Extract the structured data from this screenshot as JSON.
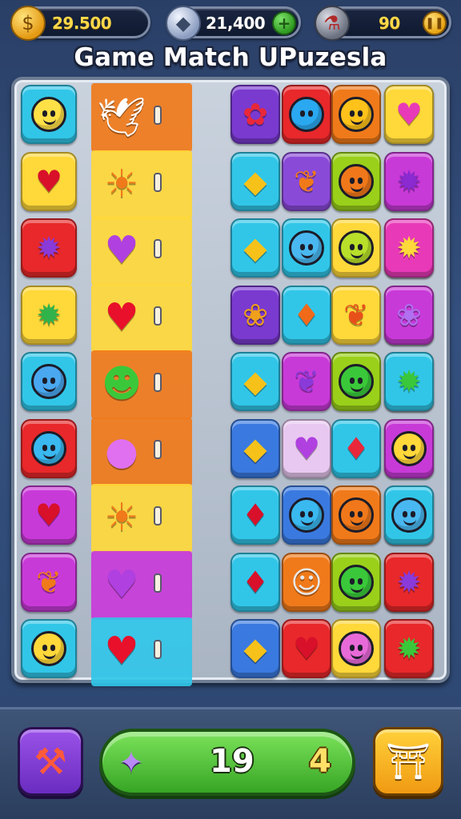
{
  "hud": {
    "coins": {
      "icon": "coin-bag-icon",
      "value": "29.500"
    },
    "gems": {
      "icon": "diamond-icon",
      "value": "21,400"
    },
    "energy": {
      "icon": "potion-icon",
      "value": "90"
    }
  },
  "title": "Game Match UPuzesla",
  "board": {
    "columns": 7,
    "rows": 9,
    "tiles": [
      [
        {
          "c": "#31c6e8",
          "s": "face",
          "f": "#ffe046"
        },
        {
          "c": "wide"
        },
        {
          "c": "wide"
        },
        {
          "c": "#7a3ad0",
          "s": "glyph",
          "g": "✿",
          "gc": "#e8283a"
        },
        {
          "c": "#e8282a",
          "s": "face-plain",
          "f": "#2aa8f0"
        },
        {
          "c": "#f07a1a",
          "s": "face",
          "f": "#ffc21a"
        },
        {
          "c": "#2fb34a",
          "s": "glyph",
          "g": "♥",
          "gc": "#3a9cf0"
        },
        {
          "c": "#ffd83a",
          "s": "glyph",
          "g": "♥",
          "gc": "#e83ab8"
        }
      ],
      [
        {
          "c": "#ffd83a",
          "s": "glyph",
          "g": "♥",
          "gc": "#d8102a"
        },
        {
          "c": "strip"
        },
        {
          "c": "#31c6e8",
          "s": "glyph",
          "g": "◆",
          "gc": "#f6c21a"
        },
        {
          "c": "#8a4ad8",
          "s": "glyph",
          "g": "❦",
          "gc": "#f07a1a"
        },
        {
          "c": "#9ad01a",
          "s": "face",
          "f": "#f0781a"
        },
        {
          "c": "#31c6e8",
          "s": "face",
          "f": "#4aa8f0"
        },
        {
          "c": "#c83ad8",
          "s": "glyph",
          "g": "✹",
          "gc": "#8a2ad0"
        }
      ],
      [
        {
          "c": "#e8282a",
          "s": "glyph",
          "g": "✹",
          "gc": "#8a3ad8"
        },
        {
          "c": "strip"
        },
        {
          "c": "#31c6e8",
          "s": "glyph",
          "g": "◆",
          "gc": "#f6c21a"
        },
        {
          "c": "#31c6e8",
          "s": "face",
          "f": "#4ab8f0"
        },
        {
          "c": "#ffd83a",
          "s": "face",
          "f": "#b8e02a"
        },
        {
          "c": "#f07a1a",
          "s": "glyph",
          "g": "☻",
          "gc": "#3ab83a"
        },
        {
          "c": "#e83ab8",
          "s": "glyph",
          "g": "✹",
          "gc": "#ffd83a"
        }
      ],
      [
        {
          "c": "#ffd83a",
          "s": "glyph",
          "g": "✹",
          "gc": "#2fb34a"
        },
        {
          "c": "strip"
        },
        {
          "c": "#7a3ad0",
          "s": "glyph",
          "g": "❀",
          "gc": "#f0a01a"
        },
        {
          "c": "#31c6e8",
          "s": "glyph",
          "g": "♦",
          "gc": "#f06a1a"
        },
        {
          "c": "#ffd83a",
          "s": "glyph",
          "g": "❦",
          "gc": "#e8501a"
        },
        {
          "c": "#ffb82a",
          "s": "face",
          "f": "#3ac83a"
        },
        {
          "c": "#c83ad8",
          "s": "glyph",
          "g": "❀",
          "gc": "#b070f0"
        }
      ],
      [
        {
          "c": "#31c6e8",
          "s": "face",
          "f": "#4aa8f0"
        },
        {
          "c": "strip"
        },
        {
          "c": "#31c6e8",
          "s": "glyph",
          "g": "◆",
          "gc": "#f6c21a"
        },
        {
          "c": "#c83ad8",
          "s": "glyph",
          "g": "❦",
          "gc": "#8a3ad8"
        },
        {
          "c": "#9ad01a",
          "s": "face",
          "f": "#3ac83a"
        },
        {
          "c": "#e8282a",
          "s": "glyph",
          "g": "❦",
          "gc": "#f07a1a"
        },
        {
          "c": "#31c6e8",
          "s": "glyph",
          "g": "✹",
          "gc": "#3ac83a"
        }
      ],
      [
        {
          "c": "#e8282a",
          "s": "face",
          "f": "#3ab8f0"
        },
        {
          "c": "strip"
        },
        {
          "c": "#3a7ae0",
          "s": "glyph",
          "g": "◆",
          "gc": "#f6c21a"
        },
        {
          "c": "#e8c8f0",
          "s": "glyph",
          "g": "♥",
          "gc": "#b040e0"
        },
        {
          "c": "#31c6e8",
          "s": "glyph",
          "g": "♦",
          "gc": "#e8283a"
        },
        {
          "c": "#ffb82a",
          "s": "glyph",
          "g": "❦",
          "gc": "#e8283a"
        },
        {
          "c": "#c83ad8",
          "s": "face",
          "f": "#ffd83a"
        }
      ],
      [
        {
          "c": "#c83ad8",
          "s": "glyph",
          "g": "♥",
          "gc": "#d8102a"
        },
        {
          "c": "strip"
        },
        {
          "c": "#31c6e8",
          "s": "glyph",
          "g": "♦",
          "gc": "#d8102a"
        },
        {
          "c": "#3a7ae0",
          "s": "face",
          "f": "#3ab8f0"
        },
        {
          "c": "#f07a1a",
          "s": "face",
          "f": "#f0781a"
        },
        {
          "c": "#c83ad8",
          "s": "glyph",
          "g": "♦",
          "gc": "#b040e0"
        },
        {
          "c": "#31c6e8",
          "s": "face",
          "f": "#4ab8f0"
        }
      ],
      [
        {
          "c": "#c83ad8",
          "s": "glyph",
          "g": "❦",
          "gc": "#f07a1a"
        },
        {
          "c": "strip"
        },
        {
          "c": "#31c6e8",
          "s": "glyph",
          "g": "♦",
          "gc": "#d8102a"
        },
        {
          "c": "#f07a1a",
          "s": "glyph",
          "g": "☺",
          "gc": "#e8e8e8"
        },
        {
          "c": "#9ad01a",
          "s": "face",
          "f": "#3ac83a"
        },
        {
          "c": "#ffb82a",
          "s": "glyph",
          "g": "♥",
          "gc": "#3a9cf0"
        },
        {
          "c": "#e8282a",
          "s": "glyph",
          "g": "✹",
          "gc": "#8a3ad8"
        }
      ],
      [
        {
          "c": "#31c6e8",
          "s": "face",
          "f": "#ffd83a"
        },
        {
          "c": "strip"
        },
        {
          "c": "#3a7ae0",
          "s": "glyph",
          "g": "◆",
          "gc": "#f6c21a"
        },
        {
          "c": "#e8282a",
          "s": "glyph",
          "g": "♥",
          "gc": "#d8102a"
        },
        {
          "c": "#ffd83a",
          "s": "face",
          "f": "#e86ad8"
        },
        {
          "c": "#2fb34a",
          "s": "glyph",
          "g": "♥",
          "gc": "#3a9cf0"
        },
        {
          "c": "#e8282a",
          "s": "glyph",
          "g": "✹",
          "gc": "#3ac83a"
        }
      ]
    ],
    "strip_figures": [
      {
        "g": "🕊",
        "gc": "#ffffff",
        "bg": "#f07a1a"
      },
      {
        "g": "☀",
        "gc": "#f07a1a",
        "bg": "#ffd83a"
      },
      {
        "g": "♥",
        "gc": "#b040e0",
        "bg": "#ffd83a"
      },
      {
        "g": "♥",
        "gc": "#e8102a",
        "bg": "#ffd83a"
      },
      {
        "g": "☻",
        "gc": "#3ac83a",
        "bg": "#f07a1a"
      },
      {
        "g": "●",
        "gc": "#e070f0",
        "bg": "#f07a1a"
      },
      {
        "g": "☀",
        "gc": "#f07a1a",
        "bg": "#ffd83a"
      },
      {
        "g": "♥",
        "gc": "#b040e0",
        "bg": "#c83ad8"
      },
      {
        "g": "♥",
        "gc": "#e8102a",
        "bg": "#31c6e8"
      }
    ]
  },
  "bottom": {
    "tool_icon": "hammer-icon",
    "moves_icon": "puzzle-piece-icon",
    "moves": "19",
    "moves_side": "4",
    "shop_icon": "shop-icon"
  }
}
